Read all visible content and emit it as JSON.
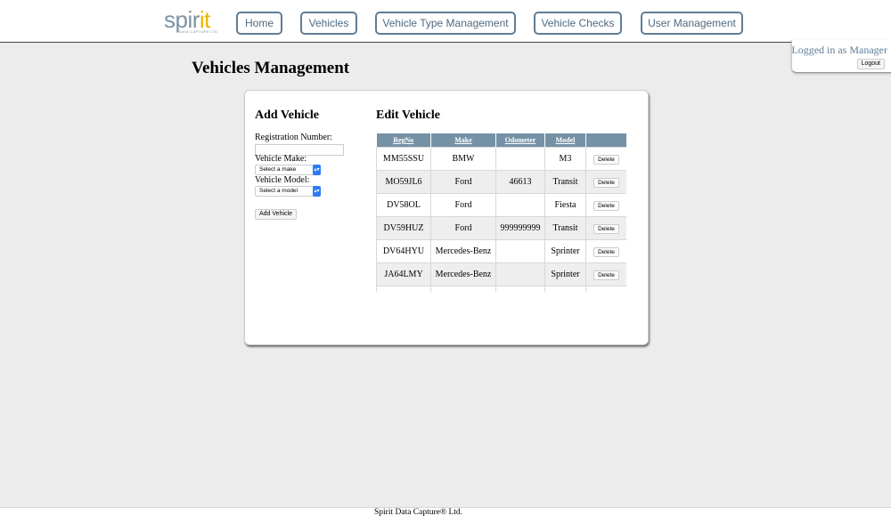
{
  "header": {
    "logo": {
      "text_main": "spir",
      "text_accent": "it",
      "tagline": "DATA CAPTURE LTD."
    },
    "nav": [
      {
        "label": "Home"
      },
      {
        "label": "Vehicles"
      },
      {
        "label": "Vehicle Type Management"
      },
      {
        "label": "Vehicle Checks"
      },
      {
        "label": "User Management"
      }
    ]
  },
  "login": {
    "status": "Logged in as Manager",
    "logout_label": "Logout"
  },
  "page": {
    "title": "Vehicles Management"
  },
  "add_vehicle": {
    "heading": "Add Vehicle",
    "reg_label": "Registration Number:",
    "reg_value": "",
    "make_label": "Vehicle Make:",
    "make_selected": "Select a make",
    "model_label": "Vehicle Model:",
    "model_selected": "Select a model",
    "add_button": "Add Vehicle"
  },
  "edit_vehicle": {
    "heading": "Edit Vehicle",
    "columns": [
      "RegNo",
      "Make",
      "Odometer",
      "Model"
    ],
    "delete_label": "Delete",
    "rows": [
      {
        "regno": "MM55SSU",
        "make": "BMW",
        "odometer": "",
        "model": "M3"
      },
      {
        "regno": "MO59JL6",
        "make": "Ford",
        "odometer": "46613",
        "model": "Transit"
      },
      {
        "regno": "DV58OL",
        "make": "Ford",
        "odometer": "",
        "model": "Fiesta"
      },
      {
        "regno": "DV59HUZ",
        "make": "Ford",
        "odometer": "999999999",
        "model": "Transit"
      },
      {
        "regno": "DV64HYU",
        "make": "Mercedes-Benz",
        "odometer": "",
        "model": "Sprinter"
      },
      {
        "regno": "JA64LMY",
        "make": "Mercedes-Benz",
        "odometer": "",
        "model": "Sprinter"
      },
      {
        "regno": "",
        "make": "",
        "odometer": "",
        "model": ""
      }
    ]
  },
  "footer": {
    "text": "Spirit Data Capture® Ltd."
  },
  "colors": {
    "accent": "#5f7d96",
    "table_header": "#7591a5",
    "logo_accent": "#f0b400",
    "select_arrow": "#2d7cf6"
  }
}
